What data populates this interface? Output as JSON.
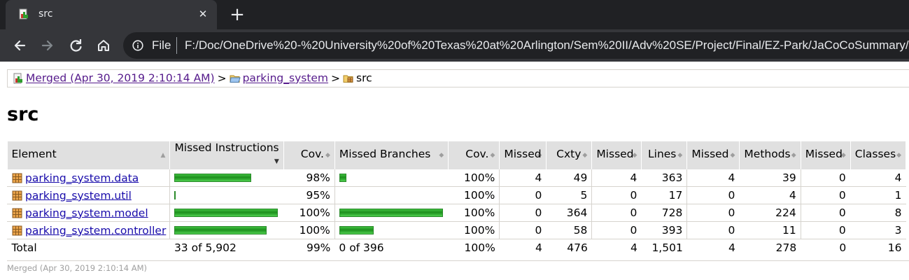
{
  "browser": {
    "tab_title": "src",
    "tab_close_glyph": "✕",
    "new_tab_glyph": "+",
    "scheme_label": "File",
    "url": "F:/Doc/OneDrive%20-%20University%20of%20Texas%20at%20Arlington/Sem%20II/Adv%20SE/Project/Final/EZ-Park/JaCoCoSummary/"
  },
  "breadcrumb": {
    "session_link": "Merged (Apr 30, 2019 2:10:14 AM)",
    "separator": ">",
    "package_link": "parking_system",
    "current": "src"
  },
  "page_title": "src",
  "table": {
    "headers": [
      "Element",
      "Missed Instructions",
      "Cov.",
      "Missed Branches",
      "Cov.",
      "Missed",
      "Cxty",
      "Missed",
      "Lines",
      "Missed",
      "Methods",
      "Missed",
      "Classes"
    ],
    "sorted_column": "Missed Instructions",
    "rows": [
      {
        "name": "parking_system.data",
        "instr_cov_bar": 0.74,
        "instr_cov": "98%",
        "branch_cov_bar": 0.07,
        "branch_cov": "100%",
        "cx_missed": "4",
        "cxty": "49",
        "lines_missed": "4",
        "lines": "363",
        "methods_missed": "4",
        "methods": "39",
        "classes_missed": "0",
        "classes": "4"
      },
      {
        "name": "parking_system.util",
        "instr_cov_bar": 0.012,
        "instr_cov": "95%",
        "branch_cov_bar": 0,
        "branch_cov": "100%",
        "cx_missed": "0",
        "cxty": "5",
        "lines_missed": "0",
        "lines": "17",
        "methods_missed": "0",
        "methods": "4",
        "classes_missed": "0",
        "classes": "1"
      },
      {
        "name": "parking_system.model",
        "instr_cov_bar": 1.0,
        "instr_cov": "100%",
        "branch_cov_bar": 1.0,
        "branch_cov": "100%",
        "cx_missed": "0",
        "cxty": "364",
        "lines_missed": "0",
        "lines": "728",
        "methods_missed": "0",
        "methods": "224",
        "classes_missed": "0",
        "classes": "8"
      },
      {
        "name": "parking_system.controller",
        "instr_cov_bar": 0.89,
        "instr_cov": "100%",
        "branch_cov_bar": 0.33,
        "branch_cov": "100%",
        "cx_missed": "0",
        "cxty": "58",
        "lines_missed": "0",
        "lines": "393",
        "methods_missed": "0",
        "methods": "11",
        "classes_missed": "0",
        "classes": "3"
      }
    ],
    "total": {
      "label": "Total",
      "instr_missed": "33 of 5,902",
      "instr_cov": "99%",
      "branch_missed": "0 of 396",
      "branch_cov": "100%",
      "cx_missed": "4",
      "cxty": "476",
      "lines_missed": "4",
      "lines": "1,501",
      "methods_missed": "4",
      "methods": "278",
      "classes_missed": "0",
      "classes": "16"
    }
  },
  "footer": "Merged (Apr 30, 2019 2:10:14 AM)",
  "colors": {
    "bar_green": "#2ea52e",
    "header_gray": "#e0e0e0",
    "link_visited": "#551a8b",
    "link": "#1a0dab"
  }
}
